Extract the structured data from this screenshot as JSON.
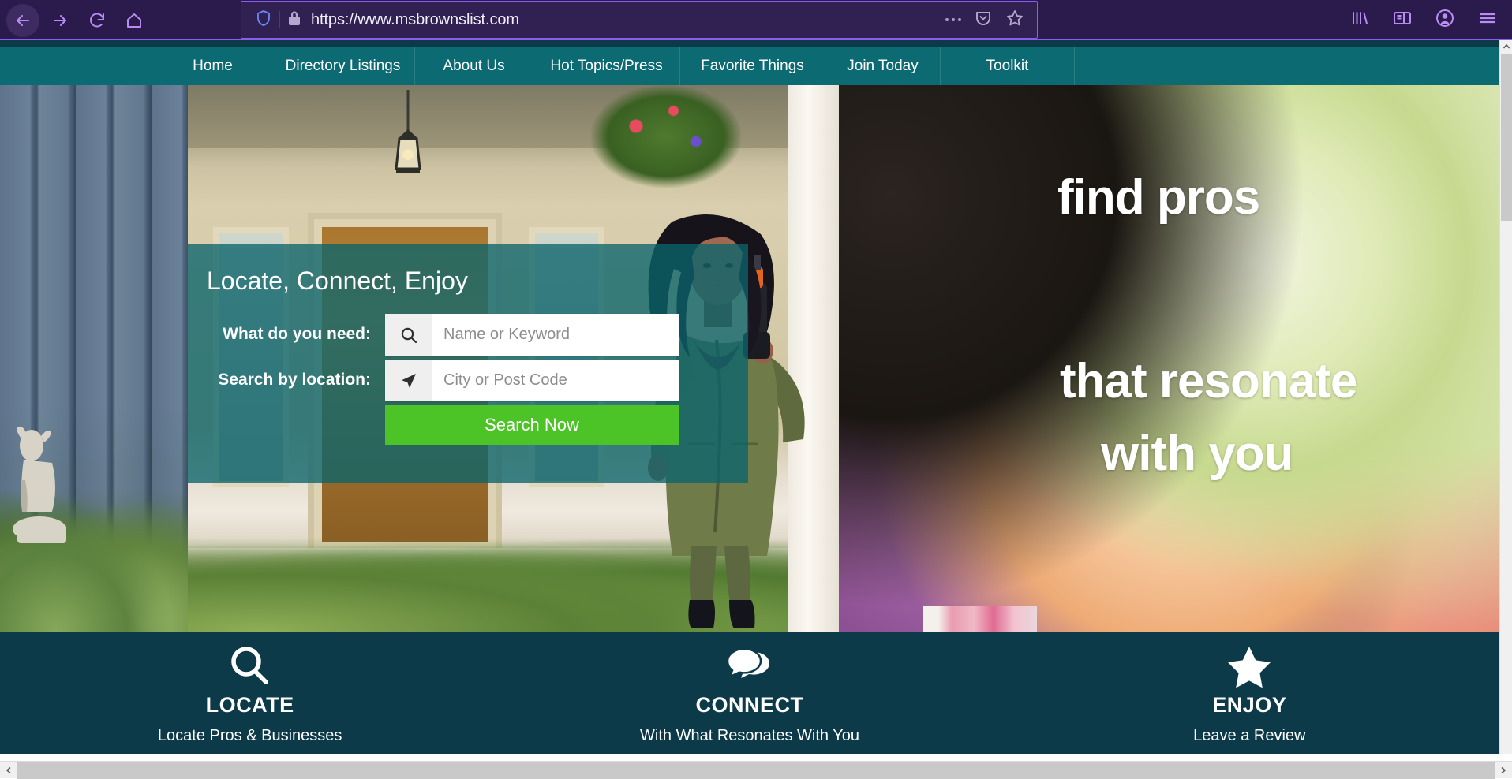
{
  "browser": {
    "url": "https://www.msbrownslist.com",
    "back_label": "Back",
    "forward_label": "Forward",
    "reload_label": "Reload",
    "home_label": "Home",
    "shield_icon": "shield-icon",
    "lock_icon": "lock-icon",
    "page_actions_icon": "page-actions-ellipsis-icon",
    "pocket_icon": "pocket-icon",
    "bookmark_icon": "bookmark-star-icon",
    "library_icon": "library-icon",
    "sidebar_icon": "sidebar-icon",
    "account_icon": "account-icon",
    "menu_icon": "hamburger-menu-icon"
  },
  "site_nav": {
    "items": [
      {
        "label": "Home"
      },
      {
        "label": "Directory Listings"
      },
      {
        "label": "About Us"
      },
      {
        "label": "Hot Topics/Press"
      },
      {
        "label": "Favorite Things"
      },
      {
        "label": "Join Today"
      },
      {
        "label": "Toolkit"
      }
    ]
  },
  "hero": {
    "headline_line1": "find pros",
    "headline_line2": "that resonate",
    "headline_line3": "with you"
  },
  "search_panel": {
    "title": "Locate, Connect, Enjoy",
    "label_need": "What do you need:",
    "label_location": "Search by location:",
    "name_placeholder": "Name or Keyword",
    "name_value": "",
    "city_placeholder": "City or Post Code",
    "city_value": "",
    "button_label": "Search Now",
    "search_icon": "search-icon",
    "location_icon": "location-arrow-icon"
  },
  "features": [
    {
      "icon": "search-icon",
      "title": "LOCATE",
      "subtitle": "Locate Pros & Businesses"
    },
    {
      "icon": "chat-bubbles-icon",
      "title": "CONNECT",
      "subtitle": "With What Resonates With You"
    },
    {
      "icon": "star-icon",
      "title": "ENJOY",
      "subtitle": "Leave a Review"
    }
  ],
  "colors": {
    "browser_chrome": "#2b1b4d",
    "browser_accent": "#8a5cf0",
    "nav_teal": "#0c6a72",
    "dark_teal": "#0c3a49",
    "panel_teal": "rgba(10,100,108,0.78)",
    "button_green": "#4cc327"
  }
}
